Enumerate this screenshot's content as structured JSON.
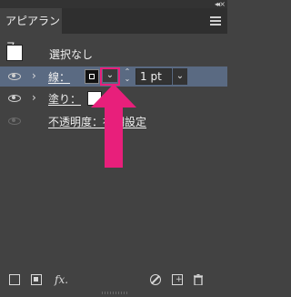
{
  "panel": {
    "tab_title": "アピアランス",
    "collapse_glyph": "◂◂",
    "close_glyph": "×"
  },
  "rows": {
    "none_label": "選択なし",
    "stroke_label": "線：",
    "stroke_weight": "1 pt",
    "fill_label": "塗り：",
    "opacity_label": "不透明度：初期設定"
  },
  "icons": {
    "dropdown": "⌄",
    "spinner_up": "⌃",
    "spinner_down": "⌄",
    "expand": "›",
    "fx": "fx."
  },
  "colors": {
    "panel_bg": "#424242",
    "selected_row": "#5a6a82",
    "annotation_pink": "#e81f7b"
  }
}
